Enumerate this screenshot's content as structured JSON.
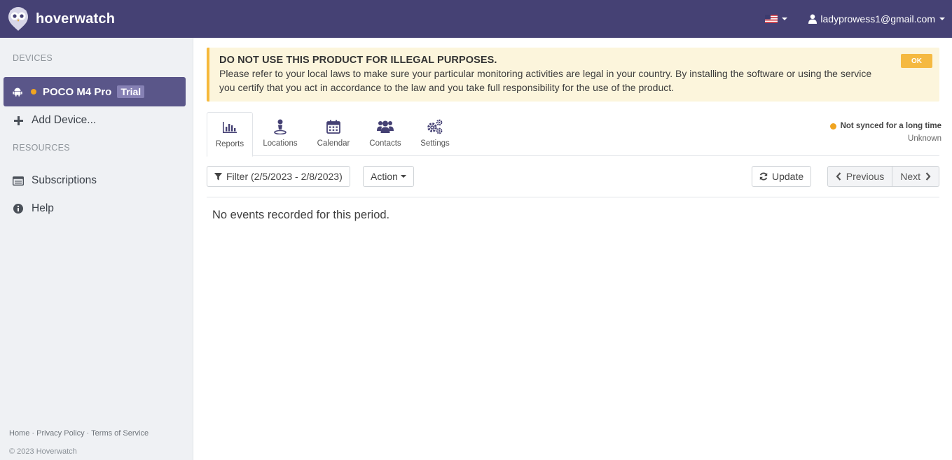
{
  "header": {
    "brand": "hoverwatch",
    "user_email": "ladyprowess1@gmail.com",
    "flag_icon": "us-flag-icon"
  },
  "sidebar": {
    "devices_heading": "DEVICES",
    "device": {
      "name": "POCO M4 Pro",
      "badge": "Trial",
      "status_color": "#f0a420"
    },
    "add_device": "Add Device...",
    "resources_heading": "RESOURCES",
    "subscriptions": "Subscriptions",
    "help": "Help",
    "footer": {
      "home": "Home",
      "privacy": "Privacy Policy",
      "terms": "Terms of Service",
      "sep": " · "
    },
    "copyright": "© 2023 Hoverwatch"
  },
  "alert": {
    "title": "DO NOT USE THIS PRODUCT FOR ILLEGAL PURPOSES.",
    "text": "Please refer to your local laws to make sure your particular monitoring activities are legal in your country. By installing the software or using the service you certify that you act in accordance to the law and you take full responsibility for the use of the product.",
    "ok_label": "OK"
  },
  "tabs": [
    {
      "label": "Reports",
      "icon": "bar-chart-icon"
    },
    {
      "label": "Locations",
      "icon": "map-pin-icon"
    },
    {
      "label": "Calendar",
      "icon": "calendar-icon"
    },
    {
      "label": "Contacts",
      "icon": "users-icon"
    },
    {
      "label": "Settings",
      "icon": "gears-icon"
    }
  ],
  "sync": {
    "status": "Not synced for a long time",
    "sub": "Unknown"
  },
  "toolbar": {
    "filter_label": "Filter (2/5/2023 - 2/8/2023)",
    "action_label": "Action",
    "update_label": "Update",
    "previous_label": "Previous",
    "next_label": "Next"
  },
  "content": {
    "empty_message": "No events recorded for this period."
  },
  "colors": {
    "header_bg": "#454174",
    "active_device_bg": "#5a5689",
    "alert_accent": "#f6b93b"
  }
}
